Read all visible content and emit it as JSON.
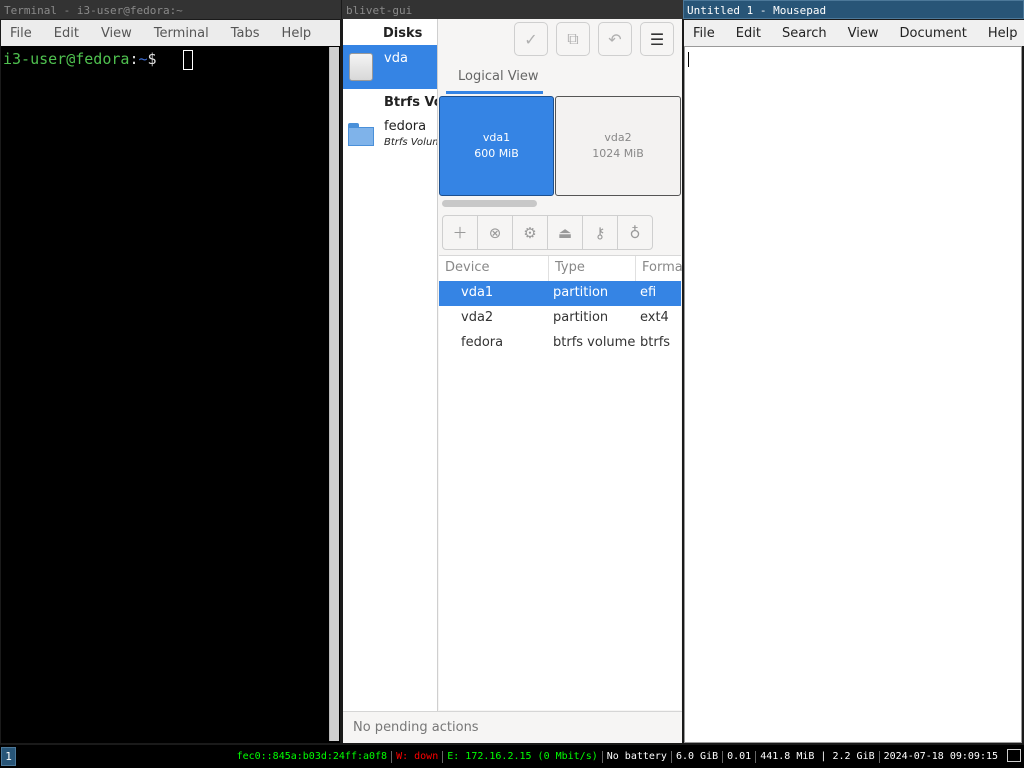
{
  "terminal": {
    "title": "Terminal - i3-user@fedora:~",
    "menu": [
      "File",
      "Edit",
      "View",
      "Terminal",
      "Tabs",
      "Help"
    ],
    "prompt_user": "i3-user@fedora",
    "prompt_sep": ":",
    "prompt_path": "~",
    "prompt_symbol": "$"
  },
  "blivet": {
    "title": "blivet-gui",
    "sidebar": {
      "disks_heading": "Disks",
      "disk_name": "vda",
      "btrfs_heading": "Btrfs Vo",
      "volume_name": "fedora",
      "volume_sub": "Btrfs Volum"
    },
    "tab_label": "Logical View",
    "blocks": [
      {
        "name": "vda1",
        "size": "600 MiB"
      },
      {
        "name": "vda2",
        "size": "1024 MiB"
      }
    ],
    "columns": [
      "Device",
      "Type",
      "Forma"
    ],
    "rows": [
      {
        "device": "vda1",
        "type": "partition",
        "format": "efi"
      },
      {
        "device": "vda2",
        "type": "partition",
        "format": "ext4"
      },
      {
        "device": "fedora",
        "type": "btrfs volume",
        "format": "btrfs"
      }
    ],
    "pending": "No pending actions"
  },
  "mousepad": {
    "title": "Untitled 1 - Mousepad",
    "menu": [
      "File",
      "Edit",
      "Search",
      "View",
      "Document",
      "Help"
    ]
  },
  "bar": {
    "workspace": "1",
    "ipv6": "fec0::845a:b03d:24ff:a0f8",
    "wifi": "W: down",
    "eth": "E: 172.16.2.15 (0 Mbit/s)",
    "battery": "No battery",
    "disk": "6.0 GiB",
    "load": "0.01",
    "mem": "441.8 MiB | 2.2 GiB",
    "datetime": "2024-07-18 09:09:15"
  },
  "colors": {
    "accent": "#3584e4",
    "i3_focused": "#285577",
    "prompt_green": "#4fc14f",
    "prompt_blue": "#3f6fd6",
    "bar_ipv6": "#00ff00",
    "bar_wifi_down": "#ff0000",
    "bar_eth": "#00ff00"
  }
}
